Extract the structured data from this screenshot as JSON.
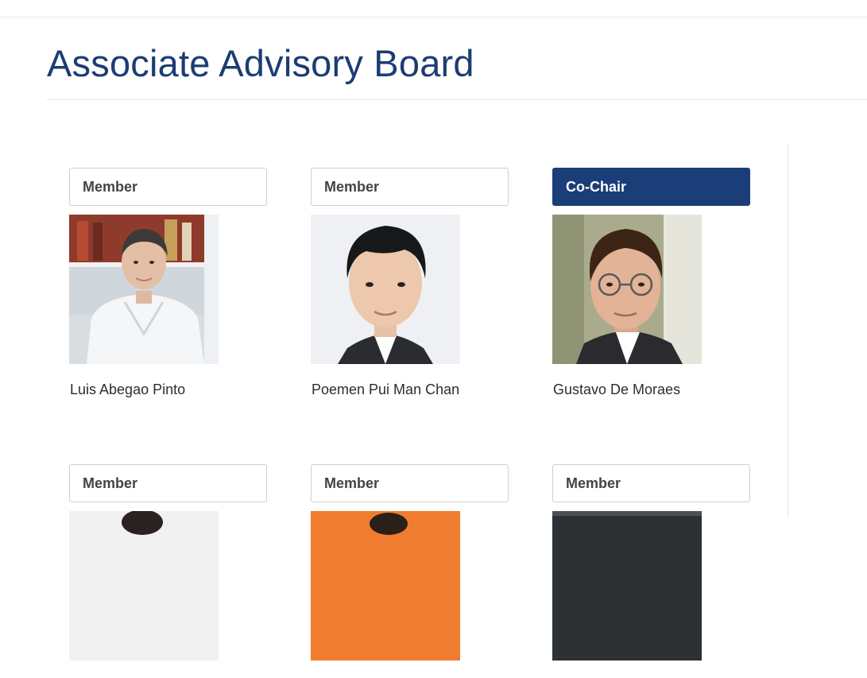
{
  "page": {
    "title": "Associate Advisory Board"
  },
  "members": [
    {
      "role": "Member",
      "name": "Luis Abegao Pinto"
    },
    {
      "role": "Member",
      "name": "Poemen Pui Man Chan"
    },
    {
      "role": "Co-Chair",
      "name": "Gustavo De Moraes"
    },
    {
      "role": "Member",
      "name": ""
    },
    {
      "role": "Member",
      "name": ""
    },
    {
      "role": "Member",
      "name": ""
    }
  ],
  "colors": {
    "heading": "#1b3d73",
    "co_chair_badge": "#1b3d78",
    "border": "#cfcfcf"
  }
}
